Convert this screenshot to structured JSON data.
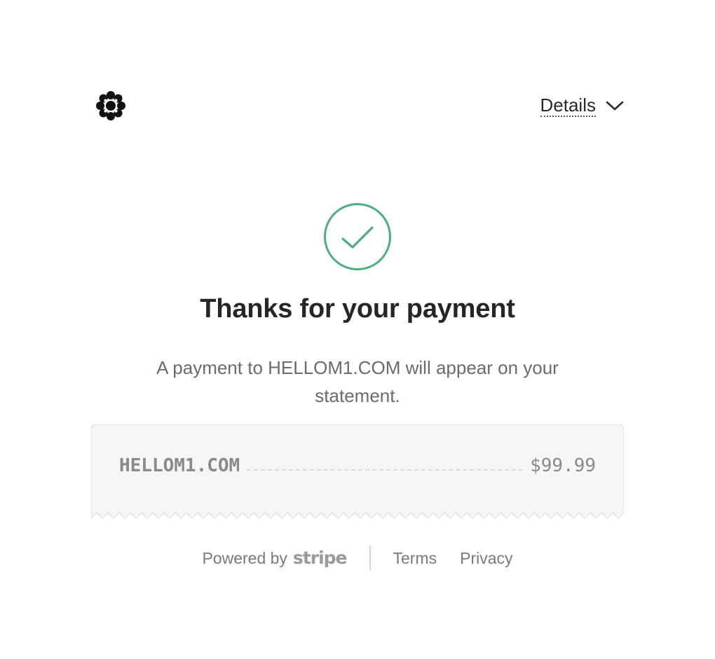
{
  "header": {
    "logo_icon": "asterisk-logo-icon",
    "details_label": "Details",
    "details_icon": "chevron-down-icon"
  },
  "confirmation": {
    "icon": "checkmark-circle-icon",
    "icon_color": "#4caf7d",
    "title": "Thanks for your payment",
    "message": "A payment to HELLOM1.COM will appear on your statement."
  },
  "receipt": {
    "merchant": "HELLOM1.COM",
    "amount": "$99.99",
    "background_color": "#f6f6f6"
  },
  "footer": {
    "powered_by_label": "Powered by",
    "brand": "stripe",
    "links": [
      {
        "label": "Terms"
      },
      {
        "label": "Privacy"
      }
    ]
  }
}
